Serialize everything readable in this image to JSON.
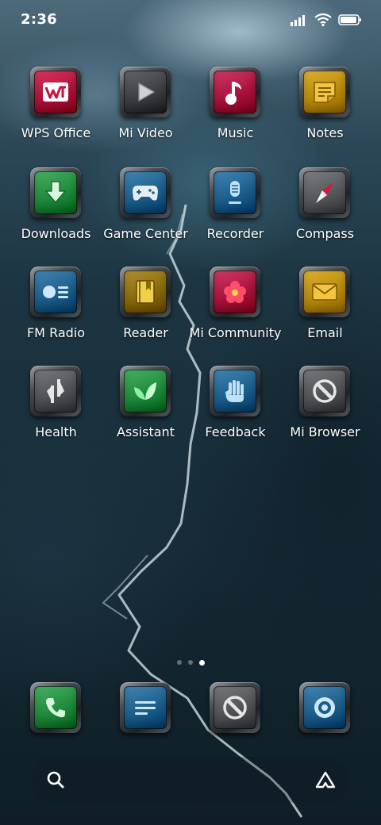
{
  "status": {
    "time": "2:36",
    "icons": [
      "signal-icon",
      "wifi-icon",
      "battery-icon"
    ],
    "battery_fill": 0.95
  },
  "apps": [
    {
      "label": "WPS Office",
      "icon": "wps-office-icon",
      "color": "#b0103a"
    },
    {
      "label": "Mi Video",
      "icon": "play-icon",
      "color": "#3c3f42"
    },
    {
      "label": "Music",
      "icon": "music-note-icon",
      "color": "#a8123c"
    },
    {
      "label": "Notes",
      "icon": "notes-icon",
      "color": "#b88a0a"
    },
    {
      "label": "Downloads",
      "icon": "download-icon",
      "color": "#1f8a3c"
    },
    {
      "label": "Game Center",
      "icon": "gamepad-icon",
      "color": "#1b5e8c"
    },
    {
      "label": "Recorder",
      "icon": "microphone-icon",
      "color": "#1b5e8c"
    },
    {
      "label": "Compass",
      "icon": "compass-icon",
      "color": "#55585b"
    },
    {
      "label": "FM Radio",
      "icon": "radio-icon",
      "color": "#1b5e8c"
    },
    {
      "label": "Reader",
      "icon": "book-icon",
      "color": "#8a6a08"
    },
    {
      "label": "Mi Community",
      "icon": "flower-icon",
      "color": "#a8123c"
    },
    {
      "label": "Email",
      "icon": "envelope-icon",
      "color": "#b88a0a"
    },
    {
      "label": "Health",
      "icon": "health-arrows-icon",
      "color": "#505356"
    },
    {
      "label": "Assistant",
      "icon": "leaf-icon",
      "color": "#1f8a3c"
    },
    {
      "label": "Feedback",
      "icon": "hand-icon",
      "color": "#1b5e8c"
    },
    {
      "label": "Mi Browser",
      "icon": "browser-icon",
      "color": "#505356"
    }
  ],
  "page_indicator": {
    "count": 3,
    "active": 2
  },
  "dock": [
    {
      "icon": "phone-icon",
      "color": "#1f8a3c"
    },
    {
      "icon": "messages-icon",
      "color": "#1b5e8c"
    },
    {
      "icon": "browser-icon",
      "color": "#505356"
    },
    {
      "icon": "camera-icon",
      "color": "#1b5e8c"
    }
  ],
  "search": {
    "icons": [
      "search-icon",
      "assistant-icon"
    ]
  }
}
